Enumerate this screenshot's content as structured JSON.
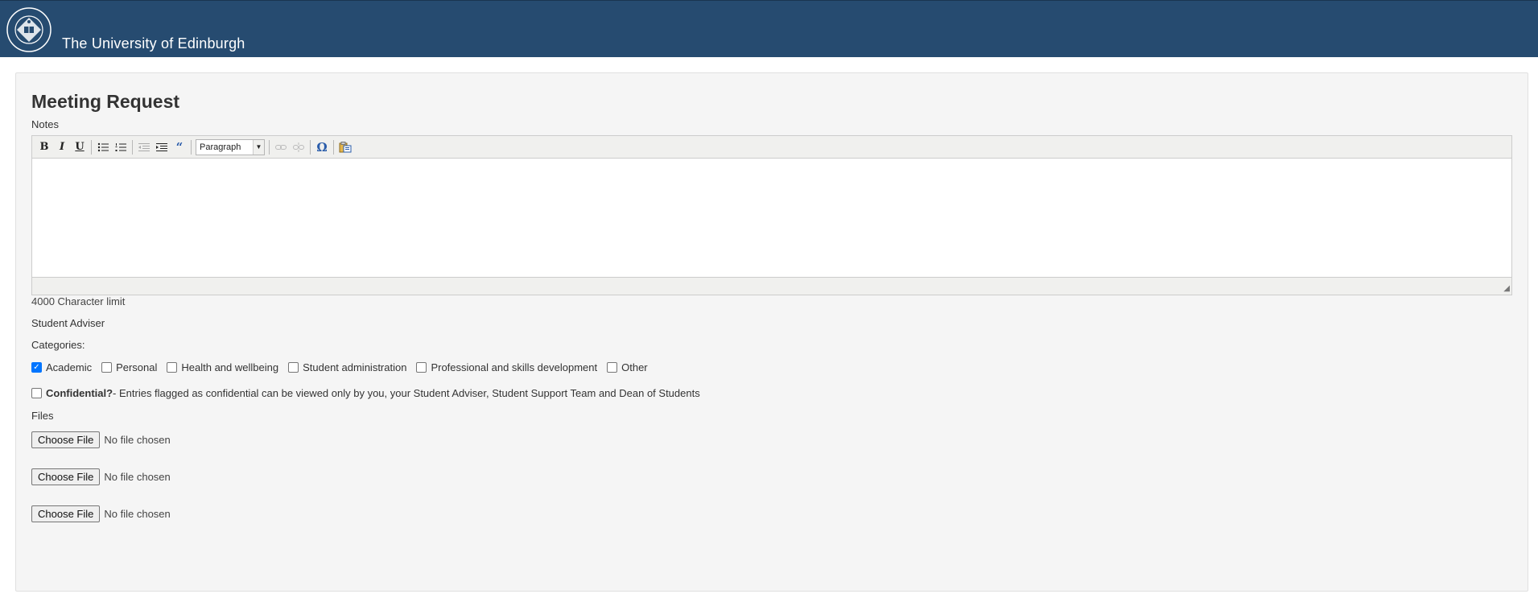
{
  "header": {
    "brand": "The University of Edinburgh",
    "crest_icon": "university-crest-icon",
    "background": "#264b70"
  },
  "form": {
    "title": "Meeting Request",
    "notes_label": "Notes",
    "editor": {
      "toolbar": {
        "bold": "B",
        "italic": "I",
        "underline": "U",
        "format_value": "Paragraph",
        "special_char": "Ω"
      },
      "content": ""
    },
    "char_limit": "4000 Character limit",
    "adviser_label": "Student Adviser",
    "categories_label": "Categories:",
    "categories": [
      {
        "label": "Academic",
        "checked": true
      },
      {
        "label": "Personal",
        "checked": false
      },
      {
        "label": "Health and wellbeing",
        "checked": false
      },
      {
        "label": "Student administration",
        "checked": false
      },
      {
        "label": "Professional and skills development",
        "checked": false
      },
      {
        "label": "Other",
        "checked": false
      }
    ],
    "confidential": {
      "label": "Confidential?",
      "description": " - Entries flagged as confidential can be viewed only by you, your Student Adviser, Student Support Team and Dean of Students",
      "checked": false
    },
    "files_label": "Files",
    "file_inputs": [
      {
        "button": "Choose File",
        "status": "No file chosen"
      },
      {
        "button": "Choose File",
        "status": "No file chosen"
      },
      {
        "button": "Choose File",
        "status": "No file chosen"
      }
    ]
  },
  "colors": {
    "accent": "#0075ff",
    "panel": "#f5f5f5"
  }
}
